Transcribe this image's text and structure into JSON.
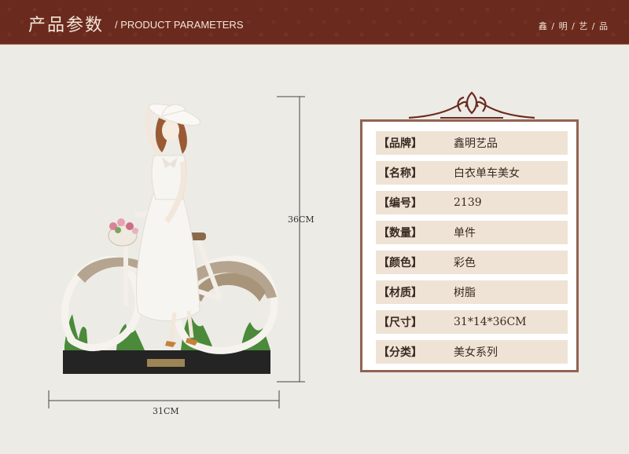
{
  "header": {
    "title": "产品参数",
    "subtitle": "/ PRODUCT PARAMETERS",
    "brand": "鑫 / 明 / 艺 / 品"
  },
  "figure": {
    "height_label": "36CM",
    "width_label": "31CM"
  },
  "params": [
    {
      "label": "【品牌】",
      "value": "鑫明艺品"
    },
    {
      "label": "【名称】",
      "value": "白衣单车美女"
    },
    {
      "label": "【编号】",
      "value": "2139"
    },
    {
      "label": "【数量】",
      "value": "单件"
    },
    {
      "label": "【颜色】",
      "value": "彩色"
    },
    {
      "label": "【材质】",
      "value": "树脂"
    },
    {
      "label": "【尺寸】",
      "value": "31*14*36CM"
    },
    {
      "label": "【分类】",
      "value": "美女系列"
    }
  ],
  "colors": {
    "banner": "#6b2a1e",
    "frame": "#926352",
    "row_bg": "#efe3d5",
    "page_bg": "#ecebe6"
  }
}
